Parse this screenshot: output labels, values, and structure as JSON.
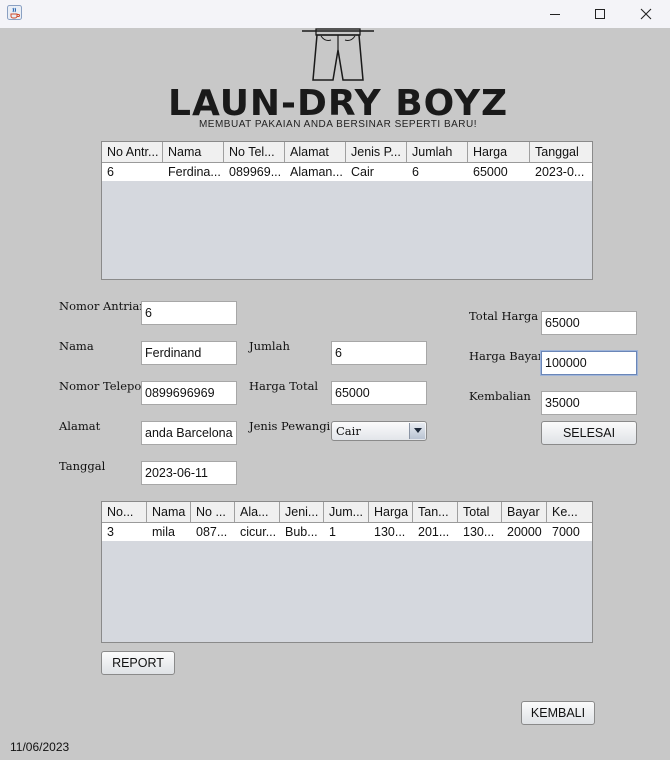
{
  "window": {
    "title": ""
  },
  "logo": {
    "title": "LAUN-DRY BOYZ",
    "subtitle": "MEMBUAT PAKAIAN ANDA BERSINAR SEPERTI BARU!"
  },
  "queue_table": {
    "columns": [
      "No Antr...",
      "Nama",
      "No Tel...",
      "Alamat",
      "Jenis P...",
      "Jumlah",
      "Harga",
      "Tanggal"
    ],
    "rows": [
      [
        "6",
        "Ferdina...",
        "089969...",
        "Alaman...",
        "Cair",
        "6",
        "65000",
        "2023-0..."
      ]
    ]
  },
  "form": {
    "nomor_antrian_label": "Nomor Antrian",
    "nomor_antrian_value": "6",
    "nama_label": "Nama",
    "nama_value": "Ferdinand",
    "nomor_telepon_label": "Nomor Telepon",
    "nomor_telepon_value": "0899696969",
    "alamat_label": "Alamat",
    "alamat_value": "anda Barcelona",
    "tanggal_label": "Tanggal",
    "tanggal_value": "2023-06-11",
    "jumlah_label": "Jumlah",
    "jumlah_value": "6",
    "harga_total_label": "Harga Total",
    "harga_total_value": "65000",
    "jenis_pewangi_label": "Jenis Pewangi",
    "jenis_pewangi_value": "Cair",
    "total_harga_label": "Total Harga",
    "total_harga_value": "65000",
    "harga_bayar_label": "Harga Bayar",
    "harga_bayar_value": "100000",
    "kembalian_label": "Kembalian",
    "kembalian_value": "35000",
    "selesai_label": "SELESAI"
  },
  "history_table": {
    "columns": [
      "No...",
      "Nama",
      "No ...",
      "Ala...",
      "Jeni...",
      "Jum...",
      "Harga",
      "Tan...",
      "Total",
      "Bayar",
      "Ke..."
    ],
    "rows": [
      [
        "3",
        "mila",
        "087...",
        "cicur...",
        "Bub...",
        "1",
        "130...",
        "201...",
        "130...",
        "20000",
        "7000"
      ]
    ]
  },
  "buttons": {
    "report_label": "REPORT",
    "kembali_label": "KEMBALI"
  },
  "status": {
    "date": "11/06/2023"
  },
  "icons": {
    "app": "java-icon",
    "minimize": "minimize-icon",
    "maximize": "maximize-icon",
    "close": "close-icon",
    "logo": "pants-hanger-icon",
    "dropdown": "chevron-down-icon"
  }
}
